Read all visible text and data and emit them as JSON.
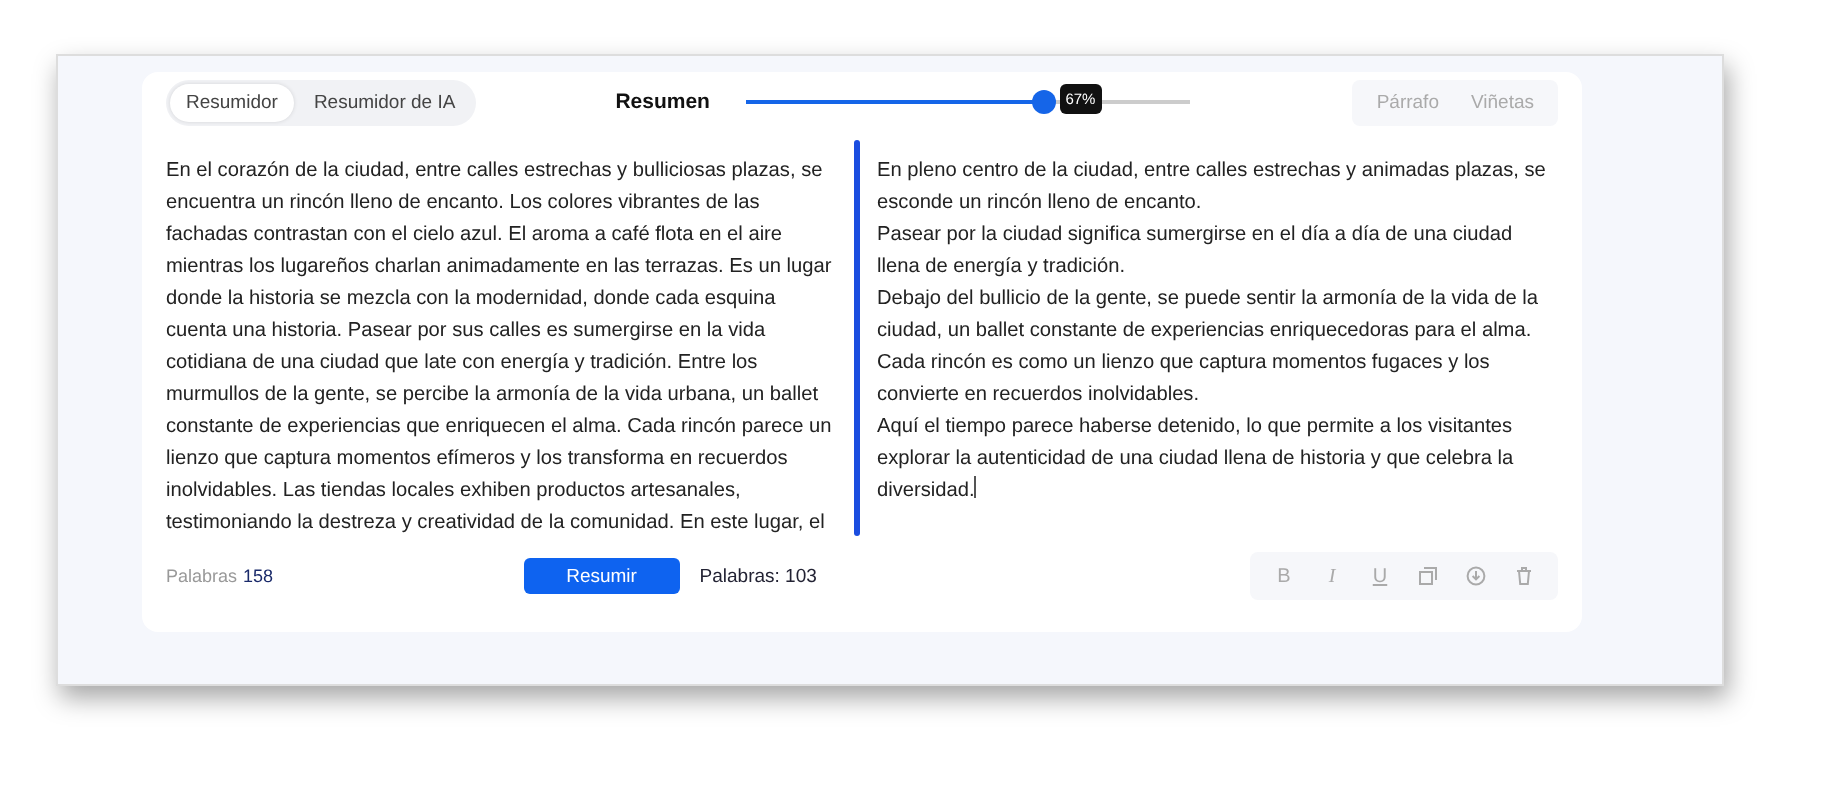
{
  "mode_tabs": [
    {
      "label": "Resumidor",
      "selected": true
    },
    {
      "label": "Resumidor de IA",
      "selected": false
    }
  ],
  "summary_slider": {
    "label": "Resumen",
    "level": 0.67,
    "reading": "67%"
  },
  "format_tabs": [
    {
      "label": "Párrafo",
      "selected": false
    },
    {
      "label": "Viñetas",
      "selected": false
    }
  ],
  "input_text": "En el corazón de la ciudad, entre calles estrechas y bulliciosas plazas, se encuentra un rincón lleno de encanto. Los colores vibrantes de las fachadas contrastan con el cielo azul. El aroma a café flota en el aire mientras los lugareños charlan animadamente en las terrazas. Es un lugar donde la historia se mezcla con la modernidad, donde cada esquina cuenta una historia. Pasear por sus calles es sumergirse en la vida cotidiana de una ciudad que late con energía y tradición. Entre los murmullos de la gente, se percibe la armonía de la vida urbana, un ballet constante de experiencias que enriquecen el alma. Cada rincón parece un lienzo que captura momentos efímeros y los transforma en recuerdos inolvidables. Las tiendas locales exhiben productos artesanales, testimoniando la destreza y creatividad de la comunidad. En este lugar, el",
  "output_paragraphs": [
    "En pleno centro de la ciudad, entre calles estrechas y animadas plazas, se esconde un rincón lleno de encanto.",
    "Pasear por la ciudad significa sumergirse en el día a día de una ciudad llena de energía y tradición.",
    "Debajo del bullicio de la gente, se puede sentir la armonía de la vida de la ciudad, un ballet constante de experiencias enriquecedoras para el alma.",
    "Cada rincón es como un lienzo que captura momentos fugaces y los convierte en recuerdos inolvidables.",
    "Aquí el tiempo parece haberse detenido, lo que permite a los visitantes explorar la autenticidad de una ciudad llena de historia y que celebra la diversidad."
  ],
  "input_word_count": {
    "label": "Palabras",
    "count": "158"
  },
  "summarize_button": "Resumir",
  "output_word_count": "Palabras: 103",
  "toolbar": [
    {
      "kind": "bold",
      "label": "B"
    },
    {
      "kind": "italic",
      "label": "I"
    },
    {
      "kind": "underline",
      "label": "U"
    },
    {
      "kind": "copy"
    },
    {
      "kind": "download"
    },
    {
      "kind": "delete"
    }
  ]
}
